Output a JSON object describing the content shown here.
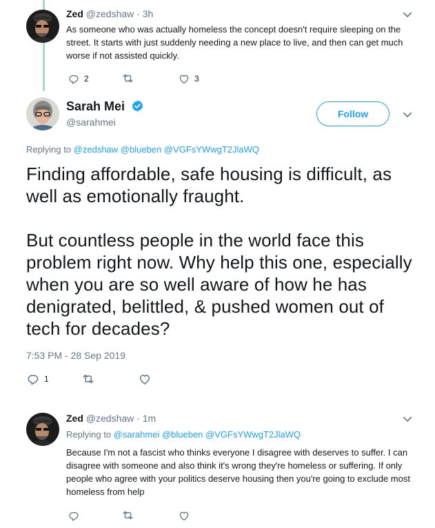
{
  "tweet1": {
    "name": "Zed",
    "handle": "@zedshaw",
    "time": "· 3h",
    "text": "As someone who was actually homeless the concept doesn't require sleeping on the street. It starts with just suddenly needing a new place to live, and then can get much worse if not assisted quickly.",
    "replies": "2",
    "retweets": "",
    "likes": "3"
  },
  "focus": {
    "name": "Sarah Mei",
    "handle": "@sarahmei",
    "follow_label": "Follow",
    "replying_prefix": "Replying to",
    "replying_to": "@zedshaw @blueben @VGFsYWwgT2JlaWQ",
    "paragraph1": "Finding affordable, safe housing is difficult, as well as emotionally fraught.",
    "paragraph2": "But countless people in the world face this problem right now. Why help this one, especially when you are so well aware of how he has denigrated, belittled, & pushed women out of tech for decades?",
    "timestamp": "7:53 PM - 28 Sep 2019",
    "replies": "1"
  },
  "tweet3": {
    "name": "Zed",
    "handle": "@zedshaw",
    "time": "· 1m",
    "replying_prefix": "Replying to",
    "replying_to": "@sarahmei @blueben @VGFsYWwgT2JlaWQ",
    "text": "Because I'm not a fascist who thinks everyone I disagree with deserves to suffer. I can disagree with someone and also think it's wrong they're homeless or suffering. If only people who agree with your politics deserve housing then you're going to exclude  most homeless from help"
  },
  "icons": {
    "reply": "reply-icon",
    "retweet": "retweet-icon",
    "like": "heart-icon",
    "caret": "chevron-down-icon",
    "verified": "verified-badge-icon"
  },
  "colors": {
    "accent": "#1da1f2",
    "secondary_text": "#657786",
    "thread_line": "#a5d6c8"
  }
}
